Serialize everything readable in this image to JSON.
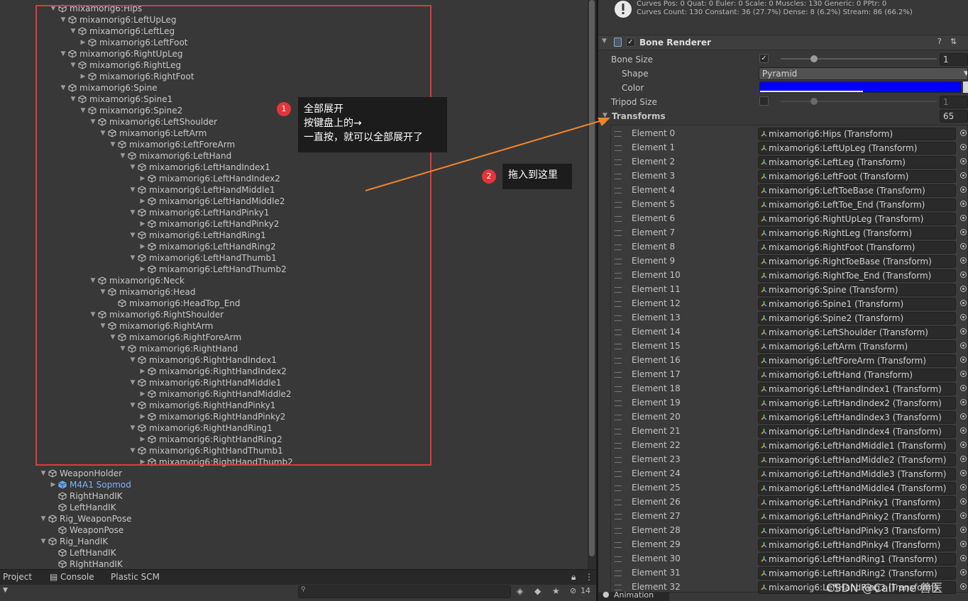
{
  "hierarchy": {
    "items": [
      {
        "label": "mixamorig6:Hips",
        "depth": 0,
        "arrow": "open"
      },
      {
        "label": "mixamorig6:LeftUpLeg",
        "depth": 1,
        "arrow": "open"
      },
      {
        "label": "mixamorig6:LeftLeg",
        "depth": 2,
        "arrow": "open"
      },
      {
        "label": "mixamorig6:LeftFoot",
        "depth": 3,
        "arrow": "closed"
      },
      {
        "label": "mixamorig6:RightUpLeg",
        "depth": 1,
        "arrow": "open"
      },
      {
        "label": "mixamorig6:RightLeg",
        "depth": 2,
        "arrow": "open"
      },
      {
        "label": "mixamorig6:RightFoot",
        "depth": 3,
        "arrow": "closed"
      },
      {
        "label": "mixamorig6:Spine",
        "depth": 1,
        "arrow": "open"
      },
      {
        "label": "mixamorig6:Spine1",
        "depth": 2,
        "arrow": "open"
      },
      {
        "label": "mixamorig6:Spine2",
        "depth": 3,
        "arrow": "open"
      },
      {
        "label": "mixamorig6:LeftShoulder",
        "depth": 4,
        "arrow": "open"
      },
      {
        "label": "mixamorig6:LeftArm",
        "depth": 5,
        "arrow": "open"
      },
      {
        "label": "mixamorig6:LeftForeArm",
        "depth": 6,
        "arrow": "open"
      },
      {
        "label": "mixamorig6:LeftHand",
        "depth": 7,
        "arrow": "open"
      },
      {
        "label": "mixamorig6:LeftHandIndex1",
        "depth": 8,
        "arrow": "open"
      },
      {
        "label": "mixamorig6:LeftHandIndex2",
        "depth": 9,
        "arrow": "closed"
      },
      {
        "label": "mixamorig6:LeftHandMiddle1",
        "depth": 8,
        "arrow": "open"
      },
      {
        "label": "mixamorig6:LeftHandMiddle2",
        "depth": 9,
        "arrow": "closed"
      },
      {
        "label": "mixamorig6:LeftHandPinky1",
        "depth": 8,
        "arrow": "open"
      },
      {
        "label": "mixamorig6:LeftHandPinky2",
        "depth": 9,
        "arrow": "closed"
      },
      {
        "label": "mixamorig6:LeftHandRing1",
        "depth": 8,
        "arrow": "open"
      },
      {
        "label": "mixamorig6:LeftHandRing2",
        "depth": 9,
        "arrow": "closed"
      },
      {
        "label": "mixamorig6:LeftHandThumb1",
        "depth": 8,
        "arrow": "open"
      },
      {
        "label": "mixamorig6:LeftHandThumb2",
        "depth": 9,
        "arrow": "closed"
      },
      {
        "label": "mixamorig6:Neck",
        "depth": 4,
        "arrow": "open"
      },
      {
        "label": "mixamorig6:Head",
        "depth": 5,
        "arrow": "open"
      },
      {
        "label": "mixamorig6:HeadTop_End",
        "depth": 6,
        "arrow": "none"
      },
      {
        "label": "mixamorig6:RightShoulder",
        "depth": 4,
        "arrow": "open"
      },
      {
        "label": "mixamorig6:RightArm",
        "depth": 5,
        "arrow": "open"
      },
      {
        "label": "mixamorig6:RightForeArm",
        "depth": 6,
        "arrow": "open"
      },
      {
        "label": "mixamorig6:RightHand",
        "depth": 7,
        "arrow": "open"
      },
      {
        "label": "mixamorig6:RightHandIndex1",
        "depth": 8,
        "arrow": "open"
      },
      {
        "label": "mixamorig6:RightHandIndex2",
        "depth": 9,
        "arrow": "closed"
      },
      {
        "label": "mixamorig6:RightHandMiddle1",
        "depth": 8,
        "arrow": "open"
      },
      {
        "label": "mixamorig6:RightHandMiddle2",
        "depth": 9,
        "arrow": "closed"
      },
      {
        "label": "mixamorig6:RightHandPinky1",
        "depth": 8,
        "arrow": "open"
      },
      {
        "label": "mixamorig6:RightHandPinky2",
        "depth": 9,
        "arrow": "closed"
      },
      {
        "label": "mixamorig6:RightHandRing1",
        "depth": 8,
        "arrow": "open"
      },
      {
        "label": "mixamorig6:RightHandRing2",
        "depth": 9,
        "arrow": "closed"
      },
      {
        "label": "mixamorig6:RightHandThumb1",
        "depth": 8,
        "arrow": "open"
      },
      {
        "label": "mixamorig6:RightHandThumb2",
        "depth": 9,
        "arrow": "closed"
      },
      {
        "label": "WeaponHolder",
        "depth": -1,
        "arrow": "open"
      },
      {
        "label": "M4A1 Sopmod",
        "depth": 0,
        "arrow": "closed",
        "prefab": true
      },
      {
        "label": "RightHandIK",
        "depth": 0,
        "arrow": "none"
      },
      {
        "label": "LeftHandIK",
        "depth": 0,
        "arrow": "none"
      },
      {
        "label": "Rig_WeaponPose",
        "depth": -1,
        "arrow": "open"
      },
      {
        "label": "WeaponPose",
        "depth": 0,
        "arrow": "none"
      },
      {
        "label": "Rig_HandIK",
        "depth": -1,
        "arrow": "open"
      },
      {
        "label": "LeftHandIK",
        "depth": 0,
        "arrow": "none"
      },
      {
        "label": "RIghtHandIK",
        "depth": 0,
        "arrow": "none"
      }
    ]
  },
  "bottom_panel": {
    "tabs": [
      "Project",
      "Console",
      "Plastic SCM"
    ],
    "hidden_count": "14",
    "search_placeholder": ""
  },
  "inspector": {
    "info_lines": [
      "Curves Pos: 0 Quat: 0 Euler: 0 Scale: 0 Muscles: 130 Generic: 0 PPtr: 0",
      "Curves Count: 130 Constant: 36 (27.7%) Dense: 8 (6.2%) Stream: 86 (66.2%)"
    ],
    "component_title": "Bone Renderer",
    "bone_size_label": "Bone Size",
    "bone_size_value": "1",
    "shape_label": "Shape",
    "shape_value": "Pyramid",
    "color_label": "Color",
    "color_value": "#0000ff",
    "tripod_label": "Tripod Size",
    "tripod_value": "1",
    "transforms_label": "Transforms",
    "transforms_count": "65",
    "elements": [
      {
        "label": "Element 0",
        "value": "mixamorig6:Hips (Transform)"
      },
      {
        "label": "Element 1",
        "value": "mixamorig6:LeftUpLeg (Transform)"
      },
      {
        "label": "Element 2",
        "value": "mixamorig6:LeftLeg (Transform)"
      },
      {
        "label": "Element 3",
        "value": "mixamorig6:LeftFoot (Transform)"
      },
      {
        "label": "Element 4",
        "value": "mixamorig6:LeftToeBase (Transform)"
      },
      {
        "label": "Element 5",
        "value": "mixamorig6:LeftToe_End (Transform)"
      },
      {
        "label": "Element 6",
        "value": "mixamorig6:RightUpLeg (Transform)"
      },
      {
        "label": "Element 7",
        "value": "mixamorig6:RightLeg (Transform)"
      },
      {
        "label": "Element 8",
        "value": "mixamorig6:RightFoot (Transform)"
      },
      {
        "label": "Element 9",
        "value": "mixamorig6:RightToeBase (Transform)"
      },
      {
        "label": "Element 10",
        "value": "mixamorig6:RightToe_End (Transform)"
      },
      {
        "label": "Element 11",
        "value": "mixamorig6:Spine (Transform)"
      },
      {
        "label": "Element 12",
        "value": "mixamorig6:Spine1 (Transform)"
      },
      {
        "label": "Element 13",
        "value": "mixamorig6:Spine2 (Transform)"
      },
      {
        "label": "Element 14",
        "value": "mixamorig6:LeftShoulder (Transform)"
      },
      {
        "label": "Element 15",
        "value": "mixamorig6:LeftArm (Transform)"
      },
      {
        "label": "Element 16",
        "value": "mixamorig6:LeftForeArm (Transform)"
      },
      {
        "label": "Element 17",
        "value": "mixamorig6:LeftHand (Transform)"
      },
      {
        "label": "Element 18",
        "value": "mixamorig6:LeftHandIndex1 (Transform)"
      },
      {
        "label": "Element 19",
        "value": "mixamorig6:LeftHandIndex2 (Transform)"
      },
      {
        "label": "Element 20",
        "value": "mixamorig6:LeftHandIndex3 (Transform)"
      },
      {
        "label": "Element 21",
        "value": "mixamorig6:LeftHandIndex4 (Transform)"
      },
      {
        "label": "Element 22",
        "value": "mixamorig6:LeftHandMiddle1 (Transform)"
      },
      {
        "label": "Element 23",
        "value": "mixamorig6:LeftHandMiddle2 (Transform)"
      },
      {
        "label": "Element 24",
        "value": "mixamorig6:LeftHandMiddle3 (Transform)"
      },
      {
        "label": "Element 25",
        "value": "mixamorig6:LeftHandMiddle4 (Transform)"
      },
      {
        "label": "Element 26",
        "value": "mixamorig6:LeftHandPinky1 (Transform)"
      },
      {
        "label": "Element 27",
        "value": "mixamorig6:LeftHandPinky2 (Transform)"
      },
      {
        "label": "Element 28",
        "value": "mixamorig6:LeftHandPinky3 (Transform)"
      },
      {
        "label": "Element 29",
        "value": "mixamorig6:LeftHandPinky4 (Transform)"
      },
      {
        "label": "Element 30",
        "value": "mixamorig6:LeftHandRing1 (Transform)"
      },
      {
        "label": "Element 31",
        "value": "mixamorig6:LeftHandRing2 (Transform)"
      },
      {
        "label": "Element 32",
        "value": "mixamorig6:LeftHandRing3 (Transform)"
      }
    ],
    "animation_tab": "Animation"
  },
  "annotations": {
    "step1_number": "1",
    "step1_lines": [
      "全部展开",
      "按键盘上的→",
      "一直按，就可以全部展开了"
    ],
    "step2_number": "2",
    "step2_text": "拖入到这里",
    "arrow_color": "#f0862a",
    "box_color": "#e0393e",
    "watermark": "CSDN @Call me 兽医"
  }
}
